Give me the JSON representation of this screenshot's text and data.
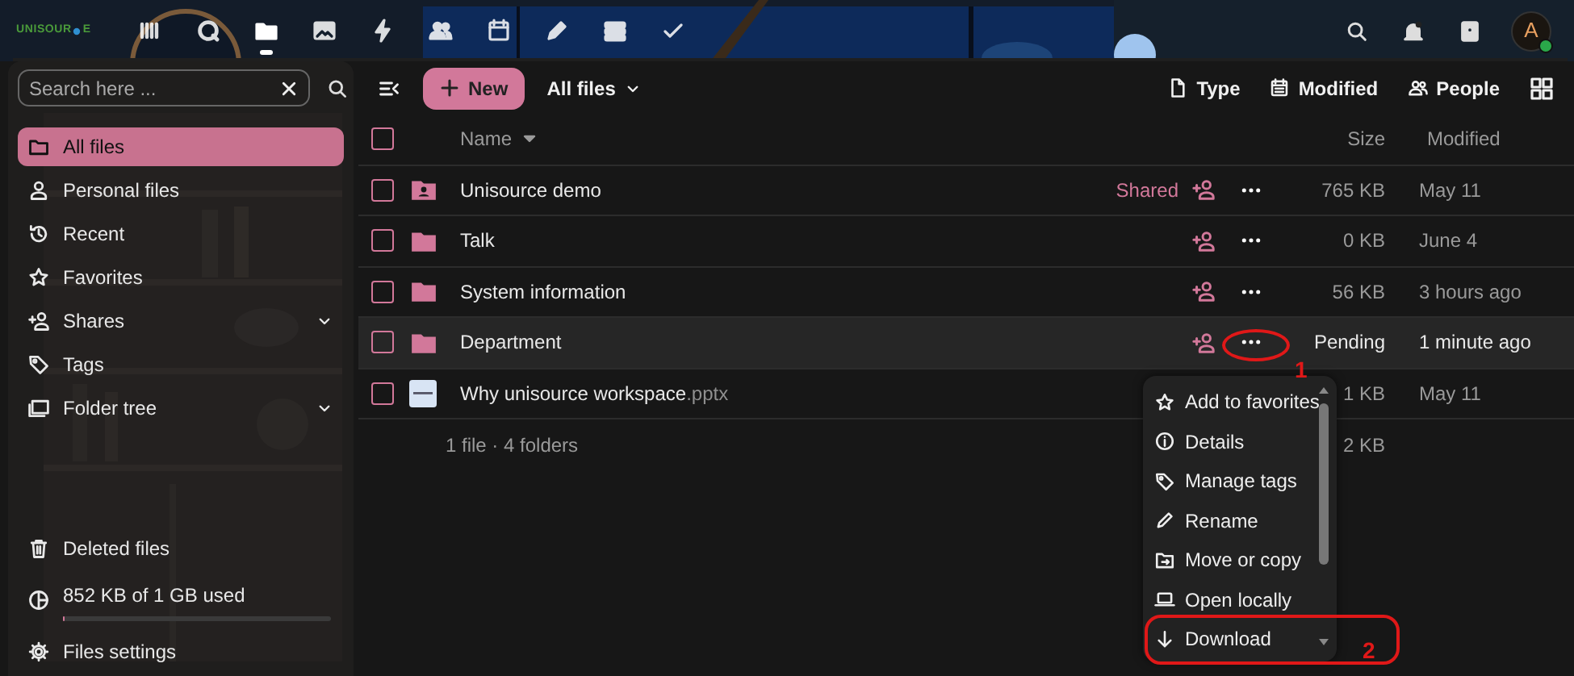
{
  "header": {
    "logo": [
      "UNISOUR",
      "E"
    ],
    "apps": [
      {
        "kind": "dashboard",
        "selected": false
      },
      {
        "kind": "search",
        "selected": false
      },
      {
        "kind": "files",
        "selected": true
      },
      {
        "kind": "photos",
        "selected": false
      },
      {
        "kind": "activity",
        "selected": false
      },
      {
        "kind": "contacts",
        "selected": false
      },
      {
        "kind": "calendar",
        "selected": false
      },
      {
        "kind": "notes",
        "selected": false
      },
      {
        "kind": "deck",
        "selected": false
      },
      {
        "kind": "tasks",
        "selected": false
      }
    ],
    "actions": [
      {
        "kind": "search"
      },
      {
        "kind": "notifications"
      },
      {
        "kind": "contacts"
      }
    ],
    "avatar": {
      "initial": "A",
      "online": true
    }
  },
  "sidebar": {
    "search": {
      "placeholder": "Search here ..."
    },
    "items": [
      {
        "kind": "folder",
        "label": "All files",
        "selected": true,
        "collapsible": false
      },
      {
        "kind": "person",
        "label": "Personal files",
        "selected": false,
        "collapsible": false
      },
      {
        "kind": "recent",
        "label": "Recent",
        "selected": false,
        "collapsible": false
      },
      {
        "kind": "star",
        "label": "Favorites",
        "selected": false,
        "collapsible": false
      },
      {
        "kind": "share",
        "label": "Shares",
        "selected": false,
        "collapsible": true
      },
      {
        "kind": "tag",
        "label": "Tags",
        "selected": false,
        "collapsible": false
      },
      {
        "kind": "tree",
        "label": "Folder tree",
        "selected": false,
        "collapsible": true
      }
    ],
    "deleted": "Deleted files",
    "storage": {
      "label": "852 KB of 1 GB used",
      "level": 0.001
    },
    "settings": "Files settings"
  },
  "toolbar": {
    "new": "New",
    "location": "All files",
    "filters": [
      {
        "kind": "type",
        "label": "Type"
      },
      {
        "kind": "modified",
        "label": "Modified"
      },
      {
        "kind": "people",
        "label": "People"
      }
    ]
  },
  "table": {
    "select_all": {
      "checked": false
    },
    "columns": [
      "Name",
      "Size",
      "Modified"
    ],
    "rows": [
      {
        "kind": "shared-folder",
        "name": "Unisource demo",
        "shared": "Shared",
        "size": "765 KB",
        "modified": "May 11",
        "checked": false,
        "highlighted": false
      },
      {
        "kind": "folder",
        "name": "Talk",
        "size": "0 KB",
        "modified": "June 4",
        "checked": false,
        "highlighted": false
      },
      {
        "kind": "folder",
        "name": "System information",
        "size": "56 KB",
        "modified": "3 hours ago",
        "checked": false,
        "highlighted": false
      },
      {
        "kind": "folder",
        "name": "Department",
        "size": "Pending",
        "modified": "1 minute ago",
        "checked": false,
        "highlighted": true
      },
      {
        "kind": "file",
        "name": "Why unisource workspace",
        "ext": ".pptx",
        "size": "1 KB",
        "modified": "May 11",
        "checked": false,
        "highlighted": false
      }
    ],
    "summary": {
      "label": "1 file · 4 folders",
      "size": "2 KB"
    }
  },
  "menu": [
    {
      "kind": "star",
      "label": "Add to favorites"
    },
    {
      "kind": "info",
      "label": "Details"
    },
    {
      "kind": "tag",
      "label": "Manage tags"
    },
    {
      "kind": "pencil",
      "label": "Rename"
    },
    {
      "kind": "move",
      "label": "Move or copy"
    },
    {
      "kind": "laptop",
      "label": "Open locally"
    },
    {
      "kind": "download",
      "label": "Download"
    }
  ],
  "annotations": [
    {
      "kind": "ellipse",
      "label": "1"
    },
    {
      "kind": "box",
      "label": "2"
    }
  ]
}
